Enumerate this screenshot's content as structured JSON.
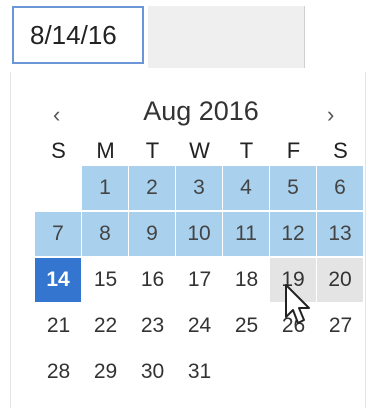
{
  "date_input": {
    "value": "8/14/16"
  },
  "calendar": {
    "month_label": "Aug 2016",
    "prev_glyph": "‹",
    "next_glyph": "›",
    "weekdays": [
      "S",
      "M",
      "T",
      "W",
      "T",
      "F",
      "S"
    ],
    "weeks": [
      [
        "",
        "1",
        "2",
        "3",
        "4",
        "5",
        "6"
      ],
      [
        "7",
        "8",
        "9",
        "10",
        "11",
        "12",
        "13"
      ],
      [
        "14",
        "15",
        "16",
        "17",
        "18",
        "19",
        "20"
      ],
      [
        "21",
        "22",
        "23",
        "24",
        "25",
        "26",
        "27"
      ],
      [
        "28",
        "29",
        "30",
        "31",
        "",
        "",
        ""
      ]
    ],
    "selected_day": "14",
    "highlighted_range": [
      "1",
      "13"
    ],
    "hovered_days": [
      "19",
      "20"
    ]
  },
  "colors": {
    "range": "#a9d1ee",
    "selected": "#3475cf",
    "hover": "#e4e4e4",
    "input_border": "#6b97d8"
  },
  "icons": {
    "cursor": "mouse-pointer-icon"
  }
}
